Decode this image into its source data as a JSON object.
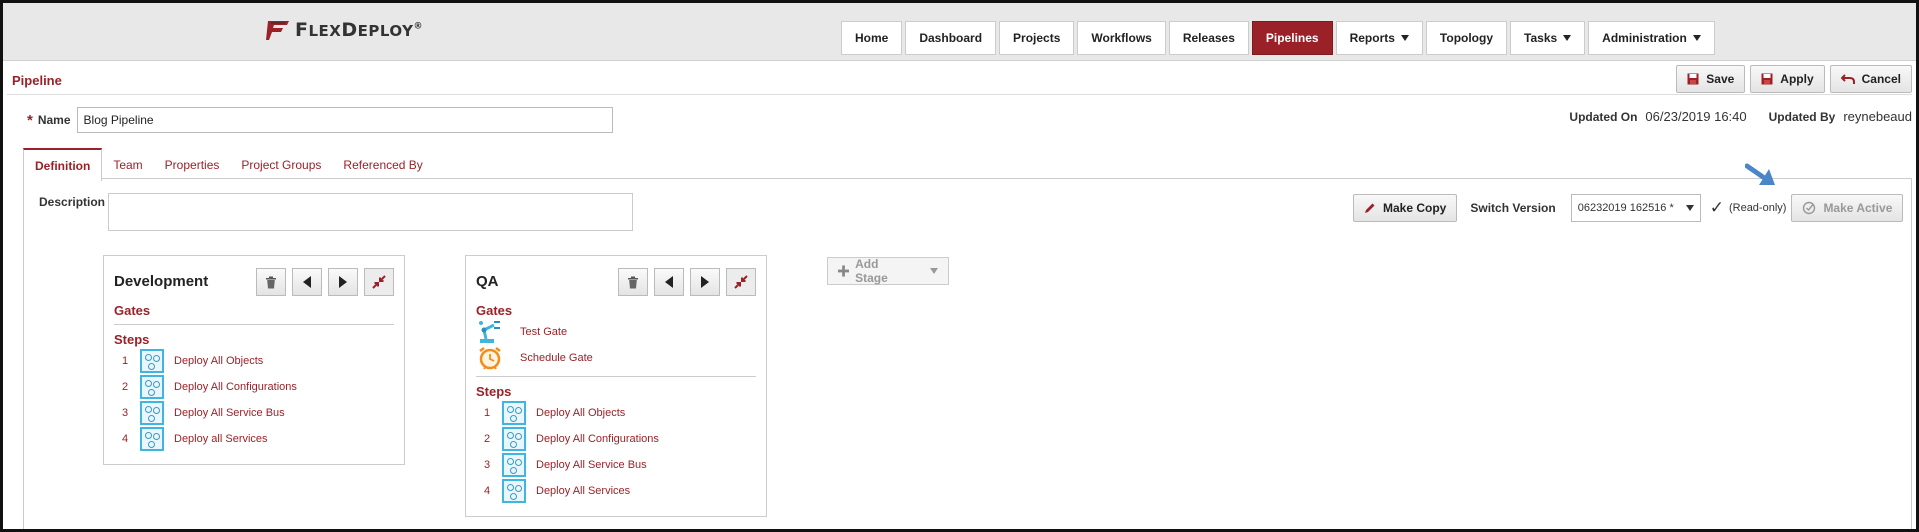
{
  "header": {
    "logo_text_big_f": "F",
    "logo_text_lex": "LEX",
    "logo_text_big_d": "D",
    "logo_text_eploy": "EPLOY",
    "logo_tm": "®"
  },
  "nav": [
    {
      "label": "Home",
      "active": false,
      "dropdown": false
    },
    {
      "label": "Dashboard",
      "active": false,
      "dropdown": false
    },
    {
      "label": "Projects",
      "active": false,
      "dropdown": false
    },
    {
      "label": "Workflows",
      "active": false,
      "dropdown": false
    },
    {
      "label": "Releases",
      "active": false,
      "dropdown": false
    },
    {
      "label": "Pipelines",
      "active": true,
      "dropdown": false
    },
    {
      "label": "Reports",
      "active": false,
      "dropdown": true
    },
    {
      "label": "Topology",
      "active": false,
      "dropdown": false
    },
    {
      "label": "Tasks",
      "active": false,
      "dropdown": true
    },
    {
      "label": "Administration",
      "active": false,
      "dropdown": true
    }
  ],
  "page": {
    "title": "Pipeline",
    "save_label": "Save",
    "apply_label": "Apply",
    "cancel_label": "Cancel",
    "name_required": "*",
    "name_label": "Name",
    "name_value": "Blog Pipeline",
    "updated_on_label": "Updated On",
    "updated_on_value": "06/23/2019 16:40",
    "updated_by_label": "Updated By",
    "updated_by_value": "reynebeaud"
  },
  "tabs": [
    {
      "label": "Definition",
      "active": true
    },
    {
      "label": "Team",
      "active": false
    },
    {
      "label": "Properties",
      "active": false
    },
    {
      "label": "Project Groups",
      "active": false
    },
    {
      "label": "Referenced By",
      "active": false
    }
  ],
  "definition": {
    "description_label": "Description",
    "description_value": "",
    "make_copy_label": "Make Copy",
    "switch_version_label": "Switch Version",
    "version_value": "06232019 162516 *",
    "readonly_label": "(Read-only)",
    "make_active_label": "Make Active",
    "add_stage_label": "Add Stage"
  },
  "stages": [
    {
      "name": "Development",
      "gates_label": "Gates",
      "gates": [],
      "steps_label": "Steps",
      "steps": [
        {
          "num": "1",
          "label": "Deploy All Objects"
        },
        {
          "num": "2",
          "label": "Deploy All Configurations"
        },
        {
          "num": "3",
          "label": "Deploy All Service Bus"
        },
        {
          "num": "4",
          "label": "Deploy all Services"
        }
      ]
    },
    {
      "name": "QA",
      "gates_label": "Gates",
      "gates": [
        {
          "label": "Test Gate",
          "icon": "robot-arm-icon"
        },
        {
          "label": "Schedule Gate",
          "icon": "alarm-clock-icon"
        }
      ],
      "steps_label": "Steps",
      "steps": [
        {
          "num": "1",
          "label": "Deploy All Objects"
        },
        {
          "num": "2",
          "label": "Deploy All Configurations"
        },
        {
          "num": "3",
          "label": "Deploy All Service Bus"
        },
        {
          "num": "4",
          "label": "Deploy All Services"
        }
      ]
    }
  ],
  "colors": {
    "brand": "#9b2128",
    "header_bg": "#e8e8e8",
    "step_icon": "#3fb5e0",
    "cue_arrow": "#4a86c8"
  }
}
